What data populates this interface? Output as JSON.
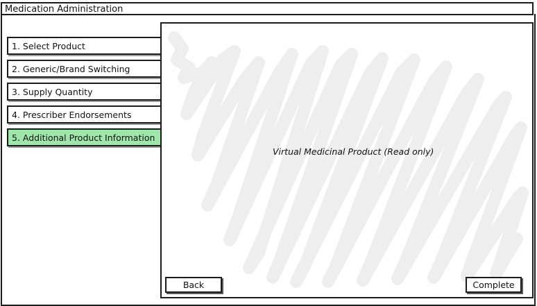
{
  "window": {
    "title": "Medication Administration"
  },
  "steps": [
    {
      "label": "1. Select Product",
      "active": false
    },
    {
      "label": "2. Generic/Brand Switching",
      "active": false
    },
    {
      "label": "3. Supply Quantity",
      "active": false
    },
    {
      "label": "4. Prescriber Endorsements",
      "active": false
    },
    {
      "label": "5. Additional Product Information",
      "active": true
    }
  ],
  "panel": {
    "placeholder_text": "Virtual Medicinal Product (Read only)"
  },
  "buttons": {
    "back_label": "Back",
    "complete_label": "Complete"
  },
  "colors": {
    "active_step": "#9fe6ab",
    "scribble": "#eeeeee",
    "border": "#1c1c1c"
  }
}
